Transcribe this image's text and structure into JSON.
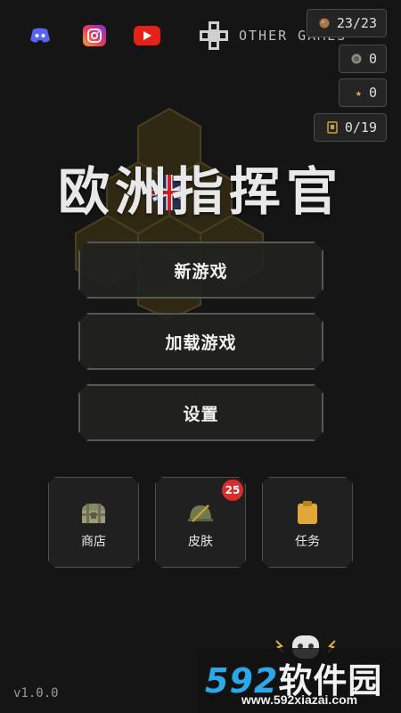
{
  "header": {
    "social": [
      {
        "name": "discord",
        "color": "#5865F2"
      },
      {
        "name": "instagram",
        "color": "#E1306C"
      },
      {
        "name": "youtube",
        "color": "#E62117"
      }
    ],
    "other_games_label": "OTHER GAMES"
  },
  "resources": {
    "energy": "23/23",
    "coins": "0",
    "stars": "0",
    "medals": "0/19"
  },
  "title": "欧洲指挥官",
  "menu": {
    "new_game": "新游戏",
    "load_game": "加载游戏",
    "settings": "设置"
  },
  "tiles": {
    "shop": "商店",
    "skins": "皮肤",
    "skins_badge": "25",
    "tasks": "任务"
  },
  "version": "v1.0.0",
  "watermark": {
    "number": "592",
    "brand": "软件园",
    "url": "www.592xiazai.com"
  },
  "colors": {
    "background": "#151515",
    "accent_gold": "#c9a23a",
    "hex_fill": "#3a3218",
    "badge": "#d62d2d"
  }
}
